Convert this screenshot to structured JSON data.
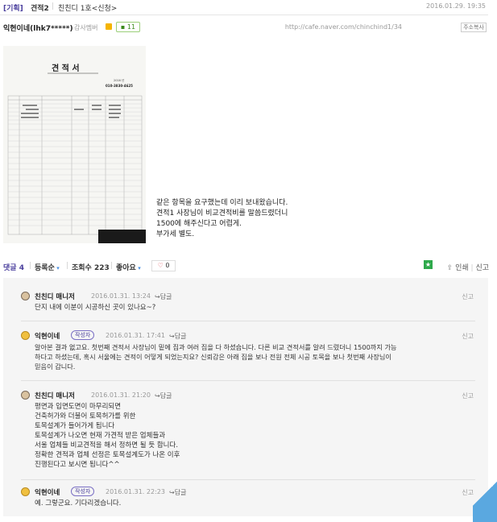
{
  "title_bar": {
    "category": "[기획]",
    "title": "견적2",
    "separator": "|",
    "subtitle": "친친디 1호<신청>",
    "date": "2016.01.29. 19:35"
  },
  "author": {
    "name": "익현이네(lhk7*****)",
    "level": "감사멤버",
    "comment_count": "11",
    "url": "http://cafe.naver.com/chinchind1/34",
    "copy_label": "주소복사"
  },
  "body_lines": [
    "같은 항목을 요구했는데 이리 보내왔습니다.",
    "견적1 사장님이 비교견적비를 말씀드렸더니",
    "1500에 해주신다고 어렵게.",
    "부가세 별도."
  ],
  "document_image": {
    "heading": "견 적 서",
    "date_text": "2016 년",
    "phone": "010-3830-4625"
  },
  "stats": {
    "comments_label": "댓글 4",
    "register_label": "등록순",
    "views_label": "조회수 223",
    "likes_label": "좋아요",
    "like_count": "0",
    "print_label": "인쇄",
    "report_label": "신고"
  },
  "comments": [
    {
      "name": "친친디 매니저",
      "tag": "",
      "date": "2016.01.31. 13:24",
      "reply": "답글",
      "report": "신고",
      "lines": [
        "단지 내에 이분이 시공하신 곳이 있나요~?"
      ]
    },
    {
      "name": "익현이네",
      "tag": "작성자",
      "date": "2016.01.31. 17:41",
      "reply": "답글",
      "report": "신고",
      "lines": [
        "알아본 결과 없고요. 첫번째 견적서 사장님이 밑에 집과 여러 집을 다 하셨습니다. 다른 비교 견적서를 알려 드렸더니 1500까지 가능",
        "하다고 하셨는데, 혹시 서울에는 견적이 어떻게 되었는지요? 신뢰감은 아래 집을 보나 전원 전체 시공 토목을 보나 첫번째 사장님이",
        "믿음이 갑니다."
      ]
    },
    {
      "name": "친친디 매니저",
      "tag": "",
      "date": "2016.01.31. 21:20",
      "reply": "답글",
      "report": "신고",
      "lines": [
        "평면과 입면도면이 마무리되면",
        "건축허가와 더불어 토목허가를 위한",
        "토목설계가 들어가게 됩니다",
        "토목설계가 나오면 현재 가견적 받은 업체들과",
        "서울 업체들 비교견적을 해서 정하면 될 듯 합니다.",
        "정확한 견적과 업체 선정은 토목설계도가 나온 이후",
        "진행된다고 보시면 됩니다^^"
      ]
    },
    {
      "name": "익현이네",
      "tag": "작성자",
      "date": "2016.01.31. 22:23",
      "reply": "답글",
      "report": "신고",
      "lines": [
        "예. 그렇군요. 기다리겠습니다."
      ]
    }
  ]
}
